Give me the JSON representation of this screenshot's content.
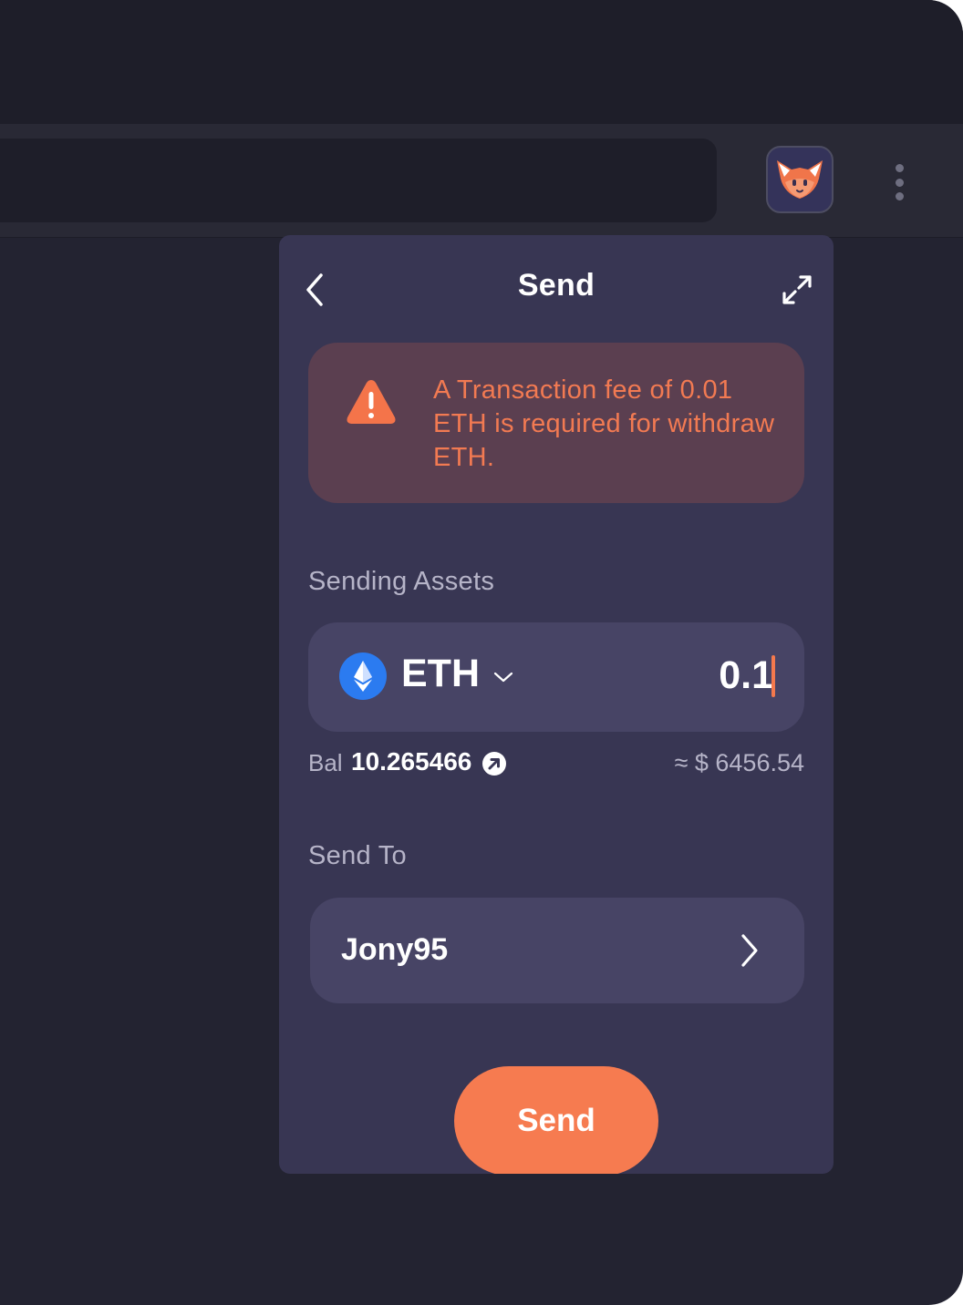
{
  "header": {
    "title": "Send",
    "back_icon": "chevron-left-icon",
    "expand_icon": "expand-icon"
  },
  "warning": {
    "icon": "warning-triangle-icon",
    "text": "A Transaction fee of 0.01 ETH is required for withdraw ETH."
  },
  "sending_assets": {
    "label": "Sending Assets",
    "asset": "ETH",
    "asset_icon": "ethereum-icon",
    "amount": "0.1",
    "balance_label": "Bal",
    "balance_value": "10.265466",
    "fiat_value": "≈ $ 6456.54"
  },
  "send_to": {
    "label": "Send To",
    "recipient": "Jony95"
  },
  "actions": {
    "send_label": "Send"
  },
  "colors": {
    "accent": "#f67b50",
    "panel": "#383653",
    "field": "#474465",
    "warning_bg": "#5b3f50",
    "warning_text": "#f27a52"
  }
}
